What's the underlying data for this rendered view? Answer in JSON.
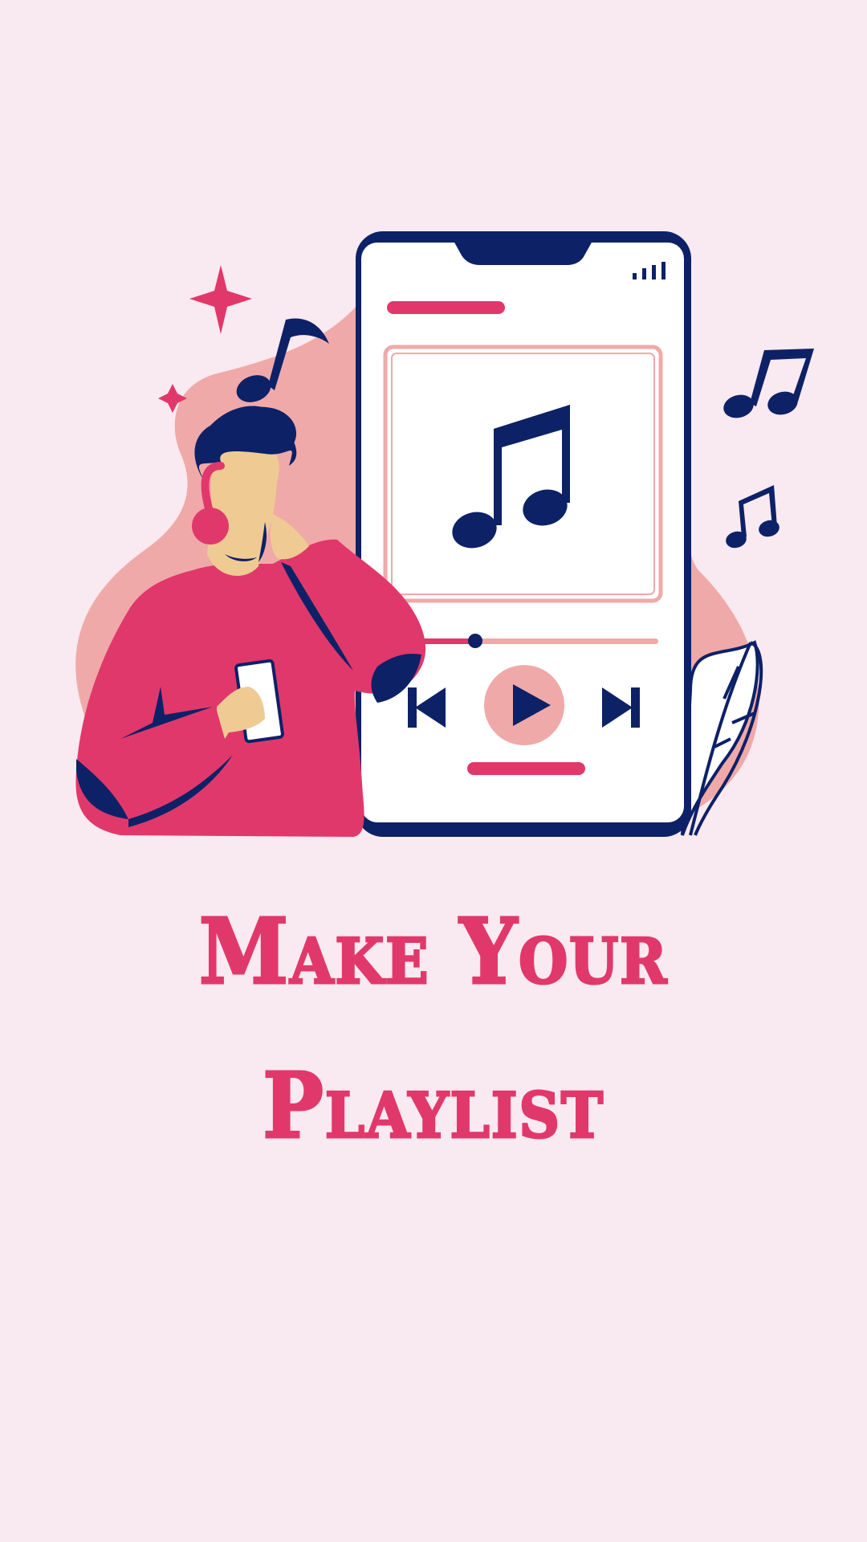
{
  "title": {
    "line1": "Make Your",
    "line2": "Playlist"
  },
  "colors": {
    "background": "#f9e9f0",
    "accent": "#e1386b",
    "navy": "#0d2167",
    "blob": "#f0a9a9",
    "skin": "#efcb93",
    "white": "#ffffff"
  },
  "player": {
    "progress": 0.24,
    "controls": [
      "previous-icon",
      "play-icon",
      "next-icon"
    ]
  },
  "icons": [
    "sparkle-icon",
    "music-note-icon",
    "double-music-note-icon",
    "signal-bars-icon",
    "leaf-icon"
  ]
}
